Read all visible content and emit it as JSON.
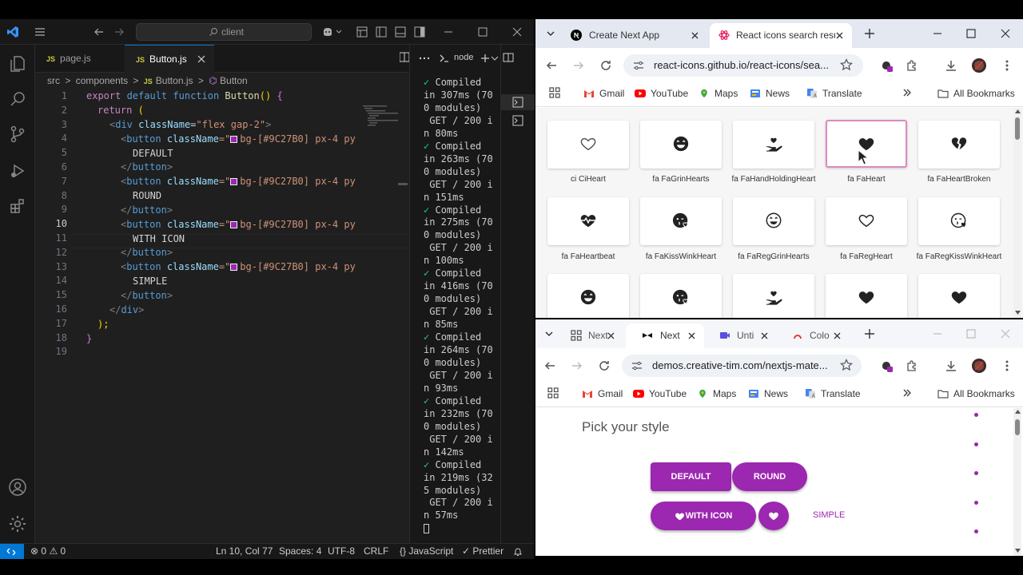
{
  "colors": {
    "vscode_bg": "#1f1f1f",
    "accent": "#0078d4",
    "button_purple": "#9C27B0",
    "terminal_ok": "#23d18b"
  },
  "vscode": {
    "search_text": "client",
    "tabs": [
      {
        "label": "page.js",
        "badge": "JS"
      },
      {
        "label": "Button.js",
        "badge": "JS"
      }
    ],
    "breadcrumb": {
      "p1": "src",
      "sep": ">",
      "p2": "components",
      "p3": "Button.js",
      "p4": "Button"
    },
    "line_numbers": [
      "1",
      "2",
      "3",
      "4",
      "5",
      "6",
      "7",
      "8",
      "9",
      "10",
      "11",
      "12",
      "13",
      "14",
      "15",
      "16",
      "17",
      "18",
      "19"
    ],
    "code": {
      "l1": {
        "a": "export",
        "b": " default ",
        "c": "function",
        "d": " Button",
        "e": "() ",
        "f": "{"
      },
      "l2": {
        "a": "return",
        "b": " ("
      },
      "l3": {
        "a": "<",
        "b": "div",
        "c": " className",
        "d": "=",
        "e": "\"flex gap-2\"",
        "f": ">"
      },
      "btn_open": {
        "a": "<",
        "b": "button",
        "c": " className",
        "d": "=\"",
        "e": "bg-[#9C27B0] px-4 py"
      },
      "btn_close": {
        "a": "</",
        "b": "button",
        "c": ">"
      },
      "l5": "DEFAULT",
      "l8": "ROUND",
      "l11": "WITH ICON",
      "l14": "SIMPLE",
      "l16": {
        "a": "</",
        "b": "div",
        "c": ">"
      },
      "l17": ");",
      "l18": "}"
    },
    "terminal": {
      "title": "node",
      "check": "✓",
      "lines": [
        {
          "compiled": "Compiled",
          "rest": "in 307ms (70\n0 modules)\n GET / 200 i\nn 80ms"
        },
        {
          "compiled": "Compiled",
          "rest": "in 263ms (70\n0 modules)\n GET / 200 i\nn 151ms"
        },
        {
          "compiled": "Compiled",
          "rest": "in 275ms (70\n0 modules)\n GET / 200 i\nn 100ms"
        },
        {
          "compiled": "Compiled",
          "rest": "in 416ms (70\n0 modules)\n GET / 200 i\nn 85ms"
        },
        {
          "compiled": "Compiled",
          "rest": "in 264ms (70\n0 modules)\n GET / 200 i\nn 93ms"
        },
        {
          "compiled": "Compiled",
          "rest": "in 232ms (70\n0 modules)\n GET / 200 i\nn 142ms"
        },
        {
          "compiled": "Compiled",
          "rest": "in 219ms (32\n5 modules)\n GET / 200 i\nn 57ms"
        }
      ]
    },
    "status": {
      "errors": "0",
      "warnings": "0",
      "position": "Ln 10, Col 77",
      "spaces": "Spaces: 4",
      "encoding": "UTF-8",
      "eol": "CRLF",
      "language": "JavaScript",
      "formatter": "Prettier"
    }
  },
  "browser_top": {
    "tabs": [
      {
        "label": "Create Next App"
      },
      {
        "label": "React icons search resu"
      }
    ],
    "url": "react-icons.github.io/react-icons/sea...",
    "bookmarks": [
      "Gmail",
      "YouTube",
      "Maps",
      "News",
      "Translate"
    ],
    "all_bookmarks": "All Bookmarks",
    "icons_row1": [
      {
        "label": "ci CiHeart",
        "icon": "heart-outline-icon"
      },
      {
        "label": "fa FaGrinHearts",
        "icon": "grin-hearts-icon"
      },
      {
        "label": "fa FaHandHoldingHeart",
        "icon": "hand-holding-heart-icon"
      },
      {
        "label": "fa FaHeart",
        "icon": "heart-icon"
      },
      {
        "label": "fa FaHeartBroken",
        "icon": "heart-broken-icon"
      }
    ],
    "icons_row2": [
      {
        "label": "fa FaHeartbeat",
        "icon": "heartbeat-icon"
      },
      {
        "label": "fa FaKissWinkHeart",
        "icon": "kiss-wink-heart-icon"
      },
      {
        "label": "fa FaRegGrinHearts",
        "icon": "reg-grin-hearts-icon"
      },
      {
        "label": "fa FaRegHeart",
        "icon": "reg-heart-icon"
      },
      {
        "label": "fa FaRegKissWinkHeart",
        "icon": "reg-kiss-wink-heart-icon"
      }
    ]
  },
  "browser_bottom": {
    "tabs": [
      {
        "label": "Next"
      },
      {
        "label": "Next"
      },
      {
        "label": "Unti"
      },
      {
        "label": "Colo"
      }
    ],
    "url": "demos.creative-tim.com/nextjs-mate...",
    "bookmarks": [
      "Gmail",
      "YouTube",
      "Maps",
      "News",
      "Translate"
    ],
    "all_bookmarks": "All Bookmarks",
    "heading": "Pick your style",
    "buttons": {
      "default": "DEFAULT",
      "round": "ROUND",
      "with_icon": "WITH ICON",
      "simple": "SIMPLE"
    }
  }
}
